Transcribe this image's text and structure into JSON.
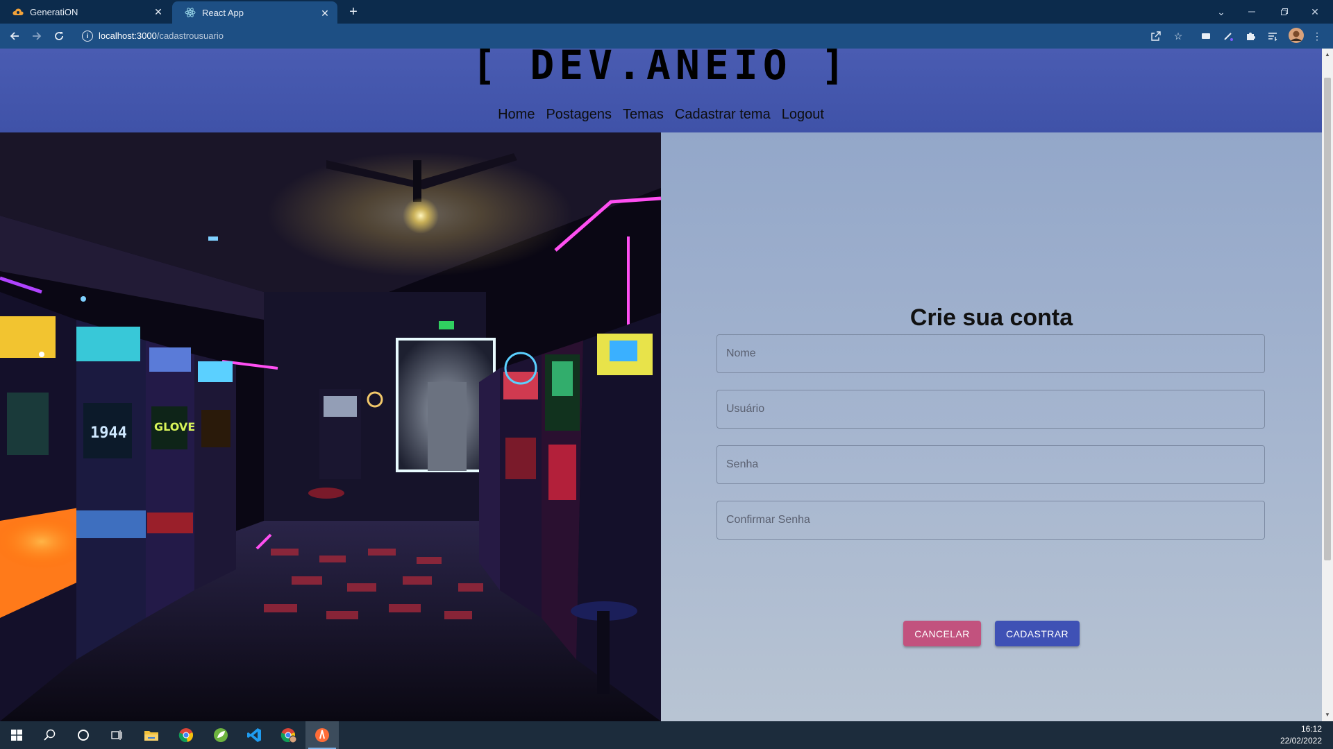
{
  "browser": {
    "tabs": [
      {
        "label": "GeneratiON",
        "favicon": "cloud-icon",
        "active": false
      },
      {
        "label": "React App",
        "favicon": "react-icon",
        "active": true
      }
    ],
    "url_host": "localhost:3000",
    "url_path": "/cadastrousuario"
  },
  "site": {
    "logo": "[ DEV.ANEIO ]",
    "nav": [
      "Home",
      "Postagens",
      "Temas",
      "Cadastrar tema",
      "Logout"
    ]
  },
  "form": {
    "title": "Crie sua conta",
    "fields": [
      {
        "placeholder": "Nome",
        "value": ""
      },
      {
        "placeholder": "Usuário",
        "value": ""
      },
      {
        "placeholder": "Senha",
        "value": ""
      },
      {
        "placeholder": "Confirmar Senha",
        "value": ""
      }
    ],
    "cancel_label": "CANCELAR",
    "submit_label": "CADASTRAR"
  },
  "taskbar": {
    "time": "16:12",
    "date": "22/02/2022",
    "apps": [
      "windows-start-icon",
      "search-icon",
      "cortana-icon",
      "task-view-icon",
      "file-explorer-icon",
      "chrome-icon",
      "spring-icon",
      "vscode-icon",
      "chrome-profile-icon",
      "postman-icon"
    ]
  },
  "colors": {
    "header": "#4a5cb2",
    "cancel_button": "#c2527e",
    "submit_button": "#3f51b5",
    "browser_chrome": "#1d4f84"
  }
}
